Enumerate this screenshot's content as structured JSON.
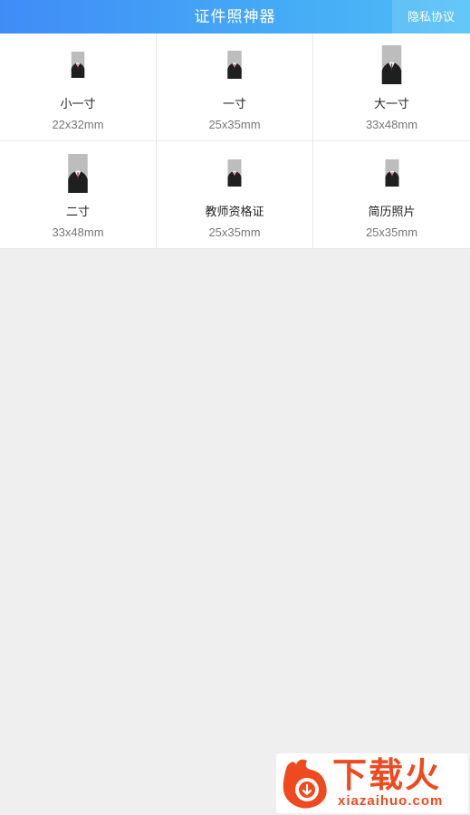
{
  "header": {
    "title": "证件照神器",
    "privacy_label": "隐私协议"
  },
  "items": [
    {
      "label": "小一寸",
      "size": "22x32mm"
    },
    {
      "label": "一寸",
      "size": "25x35mm"
    },
    {
      "label": "大一寸",
      "size": "33x48mm"
    },
    {
      "label": "二寸",
      "size": "33x48mm"
    },
    {
      "label": "教师资格证",
      "size": "25x35mm"
    },
    {
      "label": "简历照片",
      "size": "25x35mm"
    }
  ],
  "watermark": {
    "cn": "下载火",
    "en": "xiazaihuo.com",
    "color": "#ef4a1f"
  },
  "colors": {
    "header_start": "#3f8cf7",
    "header_end": "#4bbff6",
    "background": "#efefef"
  }
}
